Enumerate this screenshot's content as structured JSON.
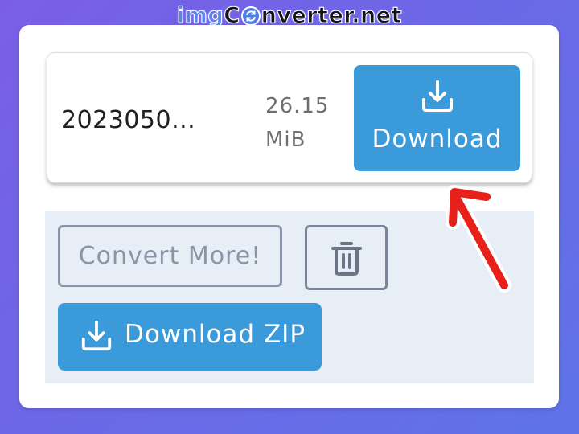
{
  "watermark": {
    "part1": "img",
    "part2_before": "C",
    "part2_after": "nverter.net"
  },
  "file": {
    "name": "2023050...",
    "size_value": "26.15",
    "size_unit": "MiB",
    "download_label": "Download"
  },
  "actions": {
    "convert_more_label": "Convert More!",
    "download_zip_label": "Download ZIP"
  },
  "icons": {
    "download": "download-icon",
    "trash": "trash-icon",
    "annotation": "red-arrow-icon"
  },
  "colors": {
    "background": "#6c67e6",
    "primary_button": "#3b9ad9",
    "outline_button": "#8b95a6",
    "actions_panel": "#e8eef6",
    "annotation_arrow": "#e8201a"
  }
}
